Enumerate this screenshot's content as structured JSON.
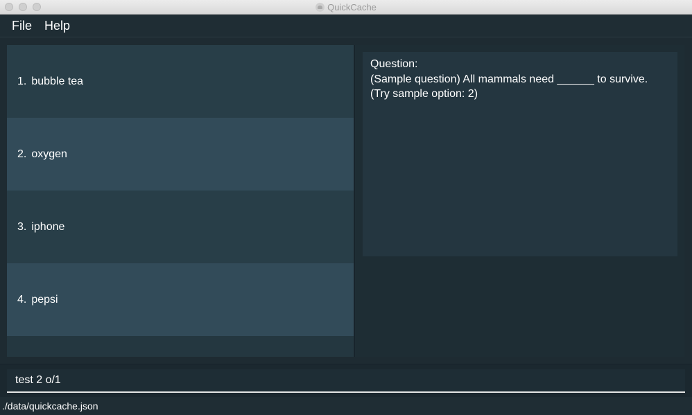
{
  "window": {
    "title": "QuickCache"
  },
  "menu": {
    "items": [
      {
        "label": "File"
      },
      {
        "label": "Help"
      }
    ]
  },
  "list": {
    "items": [
      {
        "index": "1.",
        "label": "bubble tea"
      },
      {
        "index": "2.",
        "label": "oxygen"
      },
      {
        "index": "3.",
        "label": "iphone"
      },
      {
        "index": "4.",
        "label": "pepsi"
      }
    ]
  },
  "detail": {
    "heading": "Question:",
    "text": "(Sample question) All mammals need ______ to survive. (Try sample option: 2)"
  },
  "command": {
    "value": "test 2 o/1"
  },
  "status": {
    "file_path": "./data/quickcache.json"
  },
  "colors": {
    "list_item_odd": "#283e48",
    "list_item_even": "#324b59",
    "background": "#1e2b32"
  }
}
